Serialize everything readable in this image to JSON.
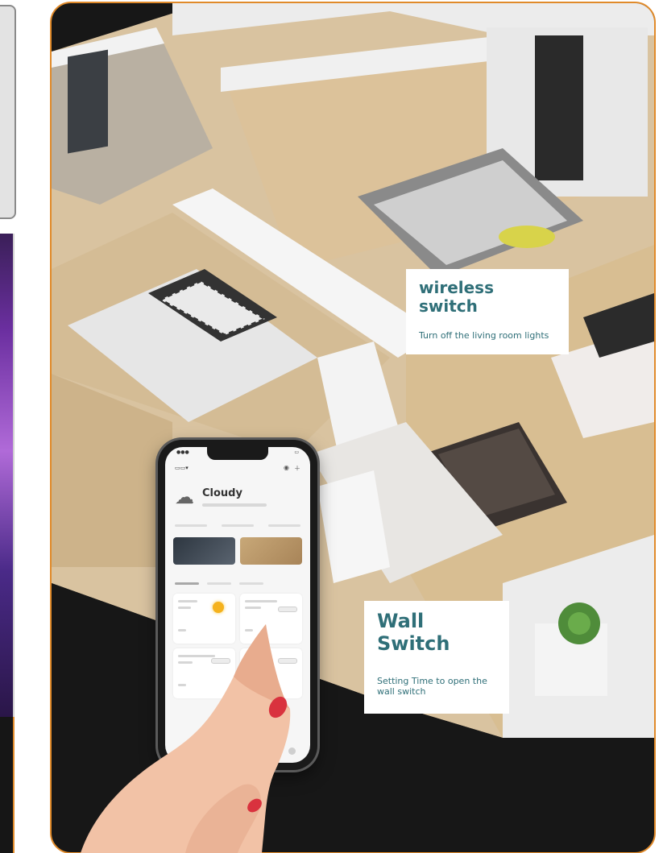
{
  "callouts": {
    "wireless": {
      "title": "wireless switch",
      "description": "Turn off the living room lights"
    },
    "wall": {
      "title": "Wall Switch",
      "description": "Setting Time to open the wall switch"
    }
  },
  "phone_app": {
    "weather_title": "Cloudy",
    "weather_icon": "cloud-sun-icon",
    "header_icons": [
      "microphone-icon",
      "plus-icon"
    ],
    "bottom_nav_icons": [
      "home-icon",
      "smart-icon",
      "profile-icon"
    ]
  },
  "colors": {
    "accent_border": "#e08a2a",
    "callout_text": "#2f6f78",
    "card_background": "#171717"
  }
}
